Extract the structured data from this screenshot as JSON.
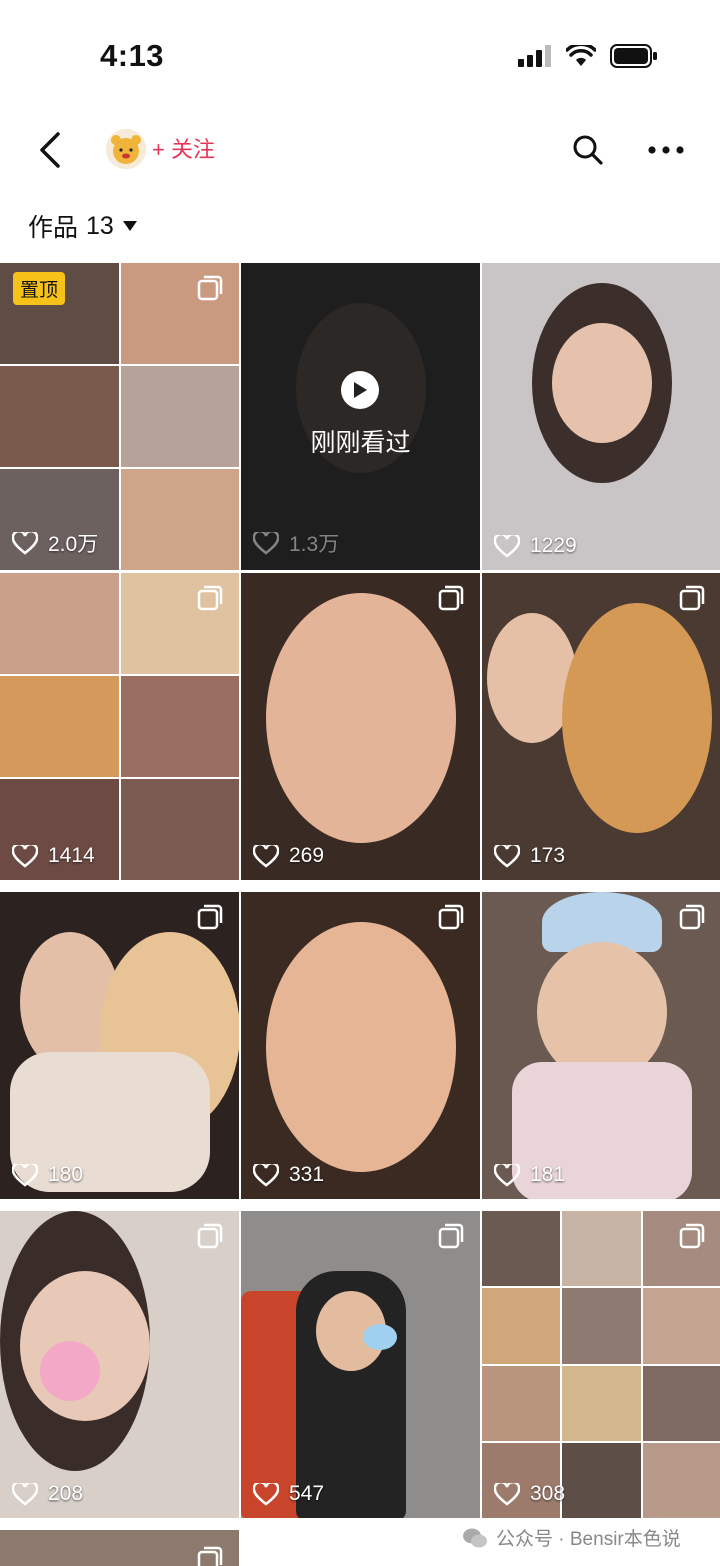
{
  "status_bar": {
    "time": "4:13"
  },
  "nav": {
    "follow_label": "+ 关注"
  },
  "works": {
    "label": "作品",
    "count": "13"
  },
  "pinned_label": "置顶",
  "watched_label": "刚刚看过",
  "tiles": [
    {
      "likes": "2.0万"
    },
    {
      "likes": "1.3万"
    },
    {
      "likes": "1229"
    },
    {
      "likes": "1414"
    },
    {
      "likes": "269"
    },
    {
      "likes": "173"
    },
    {
      "likes": "180"
    },
    {
      "likes": "331"
    },
    {
      "likes": "181"
    },
    {
      "likes": "208"
    },
    {
      "likes": "547"
    },
    {
      "likes": "308"
    }
  ],
  "watermark": {
    "text": "公众号 · Bensir本色说"
  },
  "colors": {
    "accent": "#e8355a",
    "pin_badge": "#f6c21a"
  }
}
